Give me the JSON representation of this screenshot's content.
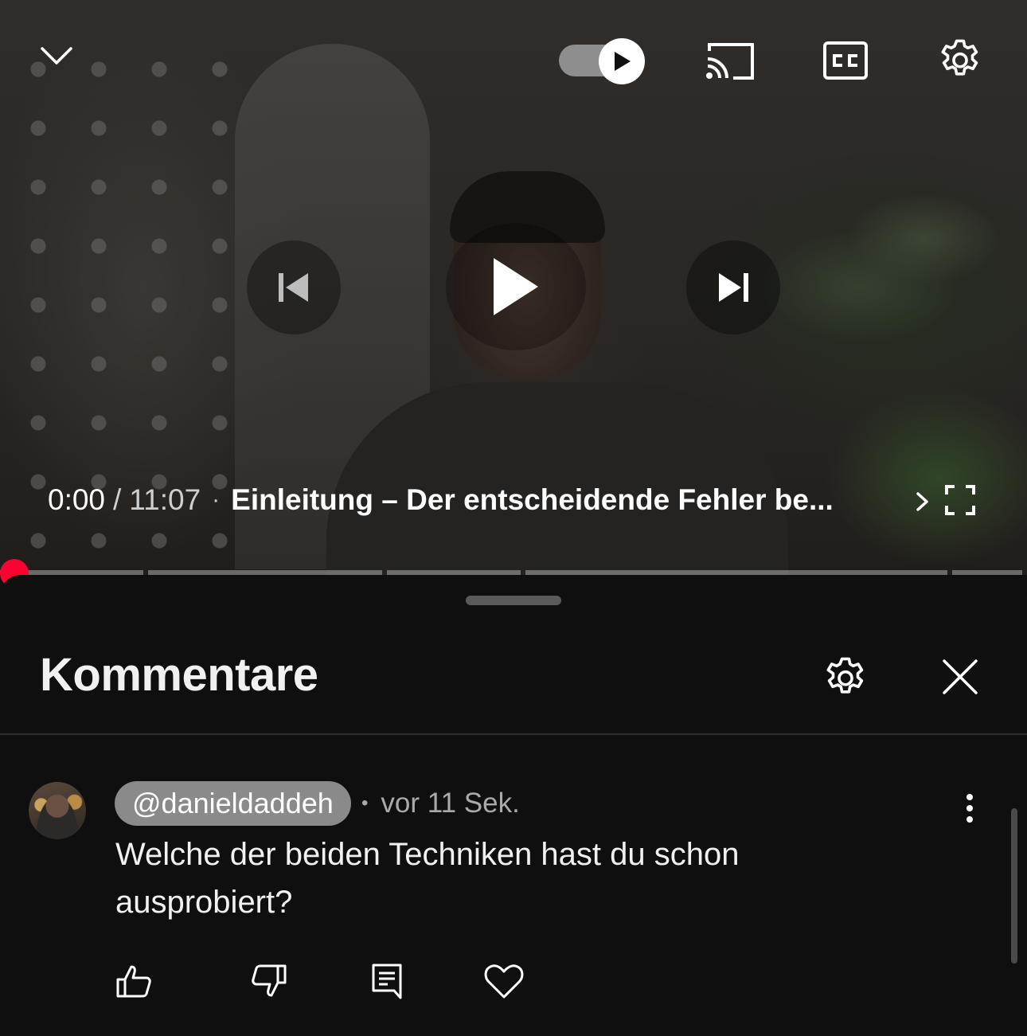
{
  "player": {
    "current_time": "0:00",
    "separator": "/",
    "duration": "11:07",
    "dot": "·",
    "chapter_title": "Einleitung – Der entscheidende Fehler be...",
    "autoplay_on": true,
    "progress_fraction": 0.0
  },
  "icons": {
    "collapse": "chevron-down-icon",
    "cast": "cast-icon",
    "captions": "closed-captions-icon",
    "settings": "gear-icon",
    "previous": "skip-previous-icon",
    "play": "play-icon",
    "next": "skip-next-icon",
    "chapter_next": "chevron-right-icon",
    "fullscreen": "fullscreen-icon"
  },
  "comments_panel": {
    "title": "Kommentare"
  },
  "comment": {
    "author": "@danieldaddeh",
    "bullet": "•",
    "time": "vor 11 Sek.",
    "text": "Welche der beiden Techniken hast du schon ausprobiert?"
  },
  "colors": {
    "background": "#0f0f0f",
    "progress_red": "#ff0033",
    "chip_gray": "#8a8a8a",
    "meta_gray": "#aaaaaa"
  }
}
